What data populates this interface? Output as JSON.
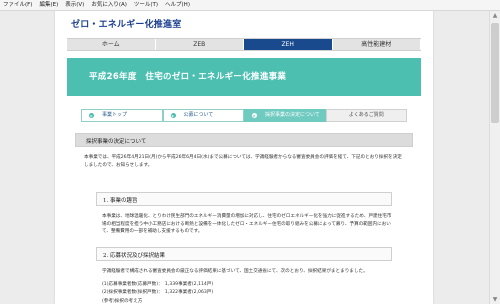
{
  "menubar": [
    "ファイル(F)",
    "編集(E)",
    "表示(V)",
    "お気に入り(A)",
    "ツール(T)",
    "ヘルプ(H)"
  ],
  "site": {
    "title": "ゼロ・エネルギー化推進室"
  },
  "main_nav": [
    {
      "label": "ホーム",
      "active": false
    },
    {
      "label": "ZEB",
      "active": false
    },
    {
      "label": "ZEH",
      "active": true
    },
    {
      "label": "高性能建材",
      "active": false
    }
  ],
  "hero": {
    "title": "平成26年度　住宅のゼロ・エネルギー化推進事業"
  },
  "sub_tabs": [
    {
      "label": "事業トップ",
      "active": false,
      "arrow": "▸"
    },
    {
      "label": "公募について",
      "active": false,
      "arrow": "▸"
    },
    {
      "label": "採択事業の決定について",
      "active": true,
      "arrow": "▸"
    },
    {
      "label": "よくあるご質問",
      "active": false,
      "arrow": ""
    }
  ],
  "section": {
    "title": "採択事業の決定について"
  },
  "intro": "本事業では、平成26年4月21日(月)から平成26年6月4日(水)まで公募については、学識経験者からなる審査委員会の評価を経て、下記のとおり採択を決定しましたので、お知らせします。",
  "block1": {
    "heading": "1. 事業の趣旨",
    "body": "本事業は、地球温暖化、とりわけ民生部門のエネルギー消費量の増加に対応し、住宅のゼロエネルギー化を強力に促進するため、戸建住宅市場の相当程度を担う中小工務店における断熱と設備を一体化したゼロ・エネルギー住宅の取り組みを公募によって募り、予算の範囲内において、整備費用の一部を補助し支援するものです。"
  },
  "block2": {
    "heading": "2. 応募状況及び採択結果",
    "body": "学識経験者で構成される審査委員会の厳正なる評価結果に基づいて、国土交通省にて、次のとおり、採択結果がまとまりました。",
    "line1": "(1)応募事業者数(応募戸数)：　1,339事業者(2,114戸)",
    "line2": "(2)採択事業者数(採択戸数)：　1,322事業者(2,063戸)",
    "line3": "(参考)採択の考え方"
  }
}
